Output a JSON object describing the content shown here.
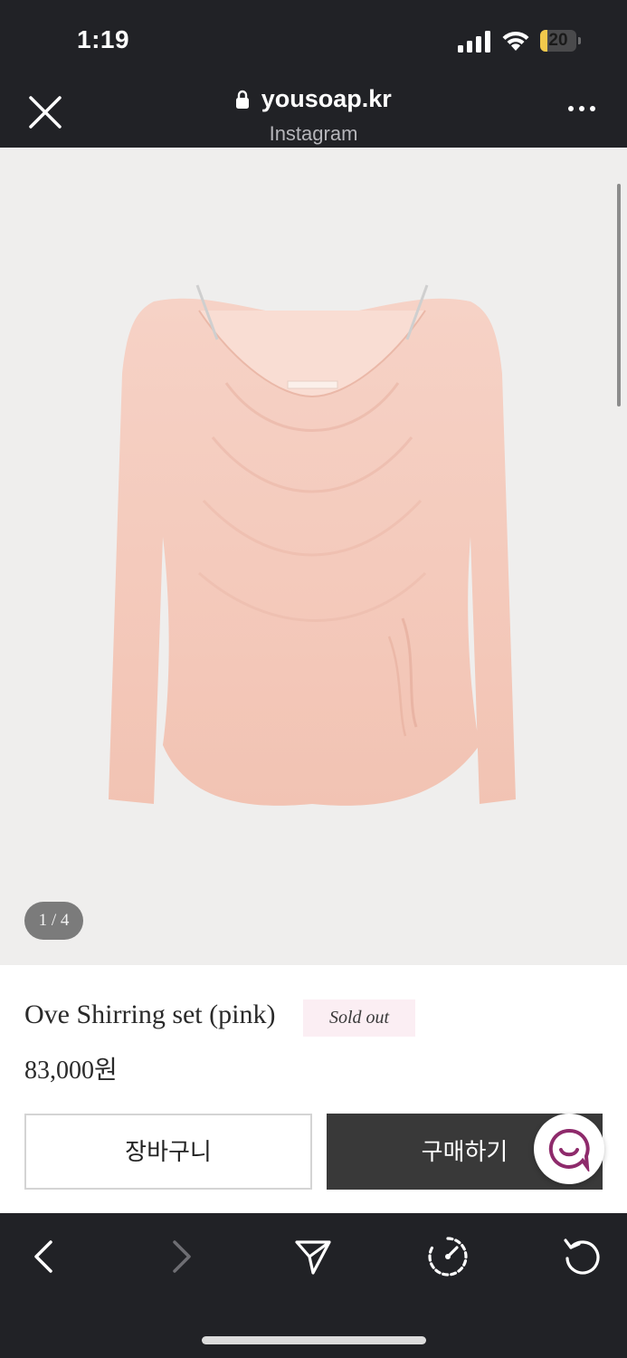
{
  "status_bar": {
    "time": "1:19",
    "battery_level": "20",
    "battery_fraction": 0.2,
    "battery_color": "#f2c94c"
  },
  "browser_nav": {
    "url": "yousoap.kr",
    "source": "Instagram",
    "close_icon": "close-icon",
    "lock_icon": "lock-icon",
    "more_icon": "more-icon"
  },
  "gallery": {
    "counter": "1 / 4",
    "background_color": "#efeeed",
    "product_color": "#f4c9bb"
  },
  "product": {
    "title": "Ove Shirring set (pink)",
    "badge": "Sold out",
    "price": "83,000원"
  },
  "actions": {
    "cart_label": "장바구니",
    "buy_label": "구매하기",
    "chat_icon": "chat-icon",
    "chat_color": "#8e2a6b"
  },
  "toolbar": {
    "items": [
      "back-icon",
      "forward-icon",
      "share-icon",
      "speed-icon",
      "reload-icon"
    ]
  }
}
